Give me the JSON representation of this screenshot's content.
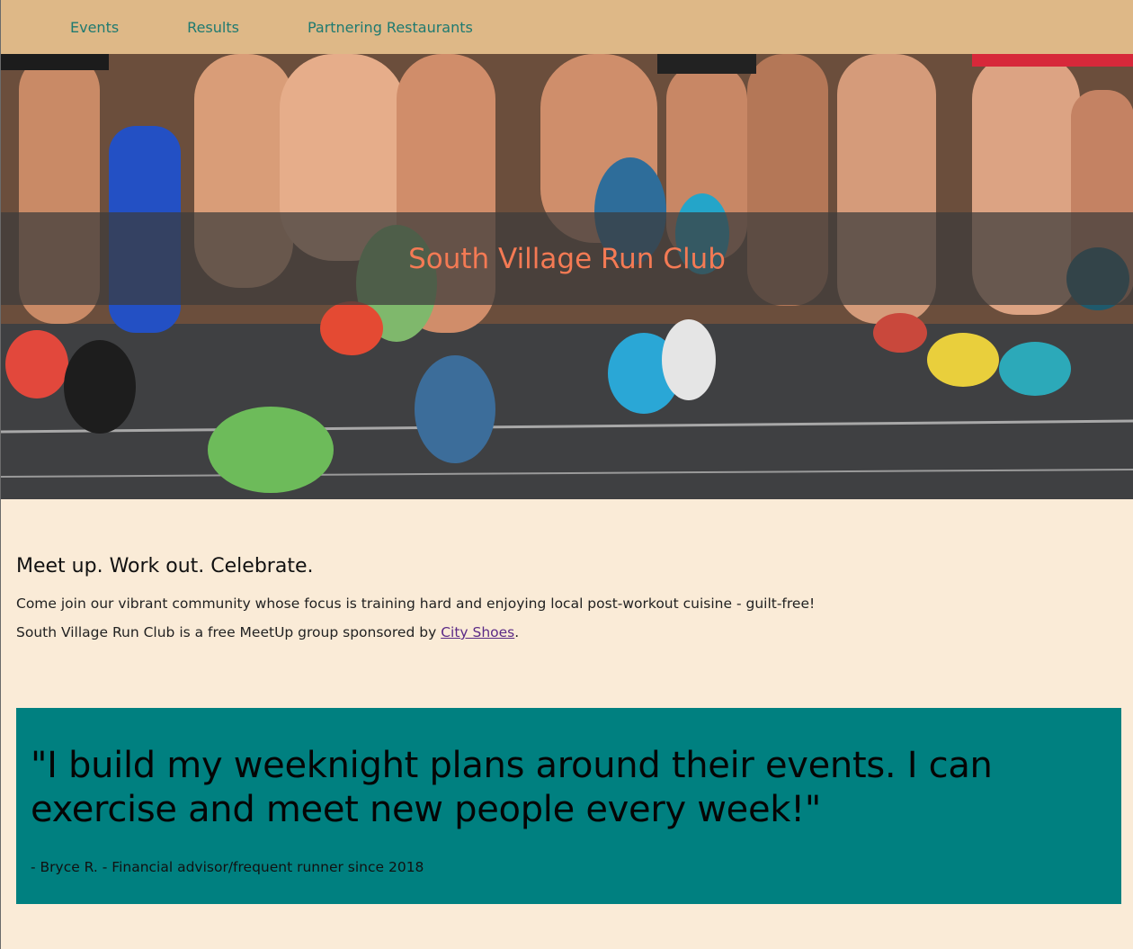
{
  "nav": {
    "items": [
      "Events",
      "Results",
      "Partnering Restaurants"
    ]
  },
  "hero": {
    "title": "South Village Run Club",
    "image": "runners-feet-on-track",
    "title_color": "#f47a54"
  },
  "intro": {
    "heading": "Meet up. Work out. Celebrate.",
    "paragraph": "Come join our vibrant community whose focus is training hard and enjoying local post-workout cuisine - guilt-free!",
    "sponsor_prefix": "South Village Run Club is a free MeetUp group sponsored by ",
    "sponsor_link": "City Shoes",
    "sponsor_suffix": "."
  },
  "testimonial": {
    "quote": "\"I build my weeknight plans around their events. I can exercise and meet new people every week!\"",
    "author": "- Bryce R. - Financial advisor/frequent runner since 2018"
  },
  "colors": {
    "nav_bg": "#deb887",
    "page_bg": "#faebd7",
    "nav_link": "#1f7a70",
    "quote_bg": "#008080"
  }
}
